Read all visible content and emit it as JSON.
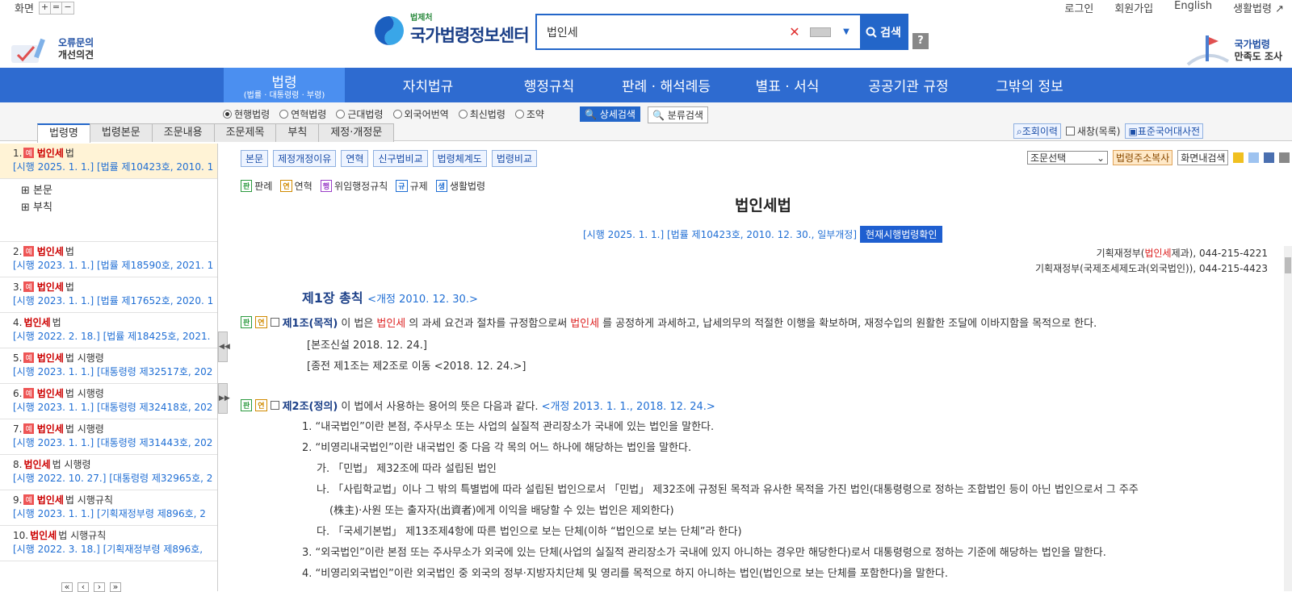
{
  "screen_control": {
    "label": "화면",
    "buttons": [
      "+",
      "=",
      "−"
    ]
  },
  "util_links": [
    "로그인",
    "회원가입",
    "English",
    "생활법령"
  ],
  "left_logo": {
    "line1": "오류문의",
    "line2": "개선의견"
  },
  "site_logo": {
    "sub": "법제처",
    "main": "국가법령정보센터"
  },
  "search": {
    "value": "법인세",
    "button": "검색",
    "help": "?"
  },
  "right_logo": {
    "line1": "국가법령",
    "line2": "만족도 조사"
  },
  "nav": [
    {
      "label": "법령",
      "sub": "(법률 · 대통령령 · 부령)"
    },
    {
      "label": "자치법규"
    },
    {
      "label": "행정규칙"
    },
    {
      "label": "판례 · 해석례등"
    },
    {
      "label": "별표 · 서식"
    },
    {
      "label": "공공기관 규정"
    },
    {
      "label": "그밖의 정보"
    }
  ],
  "radios": [
    "현행법령",
    "연혁법령",
    "근대법령",
    "외국어번역",
    "최신법령",
    "조약"
  ],
  "radio_selected": "현행법령",
  "detail_search": "상세검색",
  "class_search": "분류검색",
  "tabs": [
    "법령명",
    "법령본문",
    "조문내용",
    "조문제목",
    "부칙",
    "제정·개정문"
  ],
  "right_tools": {
    "history": "조회이력",
    "new_window": "새창(목록)",
    "dictionary": "표준국어대사전"
  },
  "results": [
    {
      "num": "1.",
      "badge": "예",
      "hl": "법인세",
      "rest": "법",
      "meta": "[시행 2025. 1. 1.] [법률 제10423호, 2010. 1"
    },
    {
      "num": "2.",
      "badge": "예",
      "hl": "법인세",
      "rest": "법",
      "meta": "[시행 2023. 1. 1.] [법률 제18590호, 2021. 1"
    },
    {
      "num": "3.",
      "badge": "예",
      "hl": "법인세",
      "rest": "법",
      "meta": "[시행 2023. 1. 1.] [법률 제17652호, 2020. 1"
    },
    {
      "num": "4.",
      "badge": "",
      "hl": "법인세",
      "rest": "법",
      "meta": "[시행 2022. 2. 18.] [법률 제18425호, 2021."
    },
    {
      "num": "5.",
      "badge": "예",
      "hl": "법인세",
      "rest": "법 시행령",
      "meta": "[시행 2023. 1. 1.] [대통령령 제32517호, 202"
    },
    {
      "num": "6.",
      "badge": "예",
      "hl": "법인세",
      "rest": "법 시행령",
      "meta": "[시행 2023. 1. 1.] [대통령령 제32418호, 202"
    },
    {
      "num": "7.",
      "badge": "예",
      "hl": "법인세",
      "rest": "법 시행령",
      "meta": "[시행 2023. 1. 1.] [대통령령 제31443호, 202"
    },
    {
      "num": "8.",
      "badge": "",
      "hl": "법인세",
      "rest": "법 시행령",
      "meta": "[시행 2022. 10. 27.] [대통령령 제32965호, 2"
    },
    {
      "num": "9.",
      "badge": "예",
      "hl": "법인세",
      "rest": "법 시행규칙",
      "meta": "[시행 2023. 1. 1.] [기획재정부령 제896호, 2"
    },
    {
      "num": "10.",
      "badge": "",
      "hl": "법인세",
      "rest": "법 시행규칙",
      "meta": "[시행 2022. 3. 18.] [기획재정부령 제896호,"
    }
  ],
  "tree": [
    "⊞ 본문",
    "⊞ 부칙"
  ],
  "content_buttons": [
    "본문",
    "제정개정이유",
    "연혁",
    "신구법비교",
    "법령체계도",
    "법령비교"
  ],
  "right_ops": {
    "select": "조문선택",
    "copy": "법령주소복사",
    "find": "화면내검색"
  },
  "legend": [
    {
      "badge": "판",
      "label": "판례",
      "color": "#2b9a3e"
    },
    {
      "badge": "연",
      "label": "연혁",
      "color": "#d08a00"
    },
    {
      "badge": "행",
      "label": "위임행정규칙",
      "color": "#9b3fc8"
    },
    {
      "badge": "규",
      "label": "규제",
      "color": "#1f6ed4"
    },
    {
      "badge": "생",
      "label": "생활법령",
      "color": "#1f6ed4"
    }
  ],
  "law": {
    "title": "법인세법",
    "meta": "[시행 2025. 1. 1.] [법률 제10423호, 2010. 12. 30., 일부개정]",
    "confirm": "현재시행법령확인",
    "ministry1_a": "기획재정부(",
    "ministry1_hl": "법인세",
    "ministry1_b": "제과), 044-215-4221",
    "ministry2": "기획재정부(국제조세제도과(외국법인)), 044-215-4423",
    "chapter": "제1장 총칙",
    "chapter_amend": "<개정 2010. 12. 30.>",
    "art1_head": "제1조(목적)",
    "art1_t1": "이 법은",
    "art1_hl1": "법인세",
    "art1_t2": "의 과세 요건과 절차를 규정함으로써",
    "art1_hl2": "법인세",
    "art1_t3": "를 공정하게 과세하고, 납세의무의 적절한 이행을 확보하며, 재정수입의 원활한 조달에 이바지함을 목적으로 한다.",
    "art1_note1": "[본조신설 2018. 12. 24.]",
    "art1_note2": "[종전 제1조는 제2조로 이동 <2018. 12. 24.>]",
    "art2_head": "제2조(정의)",
    "art2_t": "이 법에서 사용하는 용어의 뜻은 다음과 같다.",
    "art2_amend": "<개정 2013. 1. 1., 2018. 12. 24.>",
    "lines": [
      "1. “내국법인”이란 본점, 주사무소 또는 사업의 실질적 관리장소가 국내에 있는 법인을 말한다.",
      "2. “비영리내국법인”이란 내국법인 중 다음 각 목의 어느 하나에 해당하는 법인을 말한다.",
      "가. 「민법」 제32조에 따라 설립된 법인",
      "나. 「사립학교법」이나 그 밖의 특별법에 따라 설립된 법인으로서 「민법」 제32조에 규정된 목적과 유사한 목적을 가진 법인(대통령령으로 정하는 조합법인 등이 아닌 법인으로서 그 주주",
      "(株主)·사원 또는 출자자(出資者)에게 이익을 배당할 수 있는 법인은 제외한다)",
      "다. 「국세기본법」 제13조제4항에 따른 법인으로 보는 단체(이하 “법인으로 보는 단체”라 한다)",
      "3. “외국법인”이란 본점 또는 주사무소가 외국에 있는 단체(사업의 실질적 관리장소가 국내에 있지 아니하는 경우만 해당한다)로서 대통령령으로 정하는 기준에 해당하는 법인을 말한다.",
      "4. “비영리외국법인”이란 외국법인 중 외국의 정부·지방자치단체 및 영리를 목적으로 하지 아니하는 법인(법인으로 보는 단체를 포함한다)을 말한다."
    ]
  }
}
